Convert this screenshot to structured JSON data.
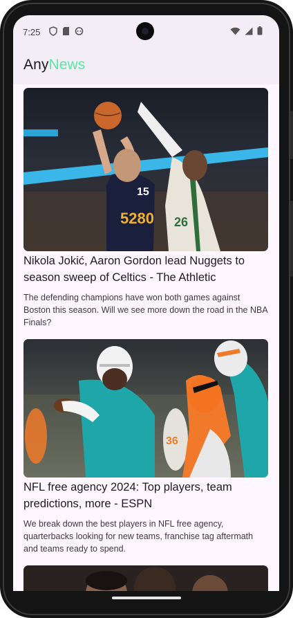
{
  "status_bar": {
    "time": "7:25",
    "left_icons": [
      "shield-icon",
      "sd-card-icon",
      "android-icon"
    ],
    "right_icons": [
      "wifi-icon",
      "signal-icon",
      "battery-icon"
    ]
  },
  "app_bar": {
    "title_part1": "Any",
    "title_part2": "News",
    "accent_color": "#58e8a3"
  },
  "articles": [
    {
      "title": "Nikola Jokić, Aaron Gordon lead Nuggets to season sweep of Celtics - The Athletic",
      "description": "The defending champions have won both games against Boston this season. Will we see more down the road in the NBA Finals?",
      "image_subject": "basketball-photo"
    },
    {
      "title": "NFL free agency 2024: Top players, team predictions, more - ESPN",
      "description": "We break down the best players in NFL free agency, quarterbacks looking for new teams, franchise tag aftermath and teams ready to spend.",
      "image_subject": "football-photo"
    },
    {
      "title": "",
      "description": "",
      "image_subject": "people-photo"
    }
  ]
}
